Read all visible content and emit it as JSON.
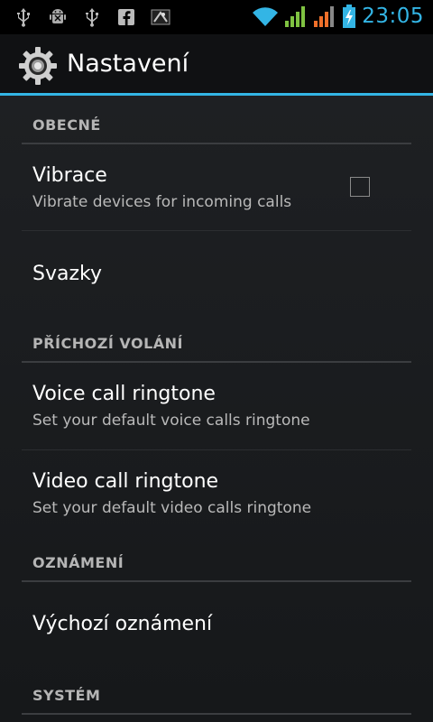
{
  "status_bar": {
    "left_icons": [
      "usb-icon",
      "android-debug-icon",
      "usb-icon",
      "facebook-icon",
      "notification-app-icon"
    ],
    "right_icons": [
      "wifi-icon",
      "signal-icon",
      "signal-roaming-icon",
      "battery-charging-icon"
    ],
    "time": "23:05"
  },
  "action_bar": {
    "title": "Nastavení",
    "icon": "settings-gear-icon"
  },
  "sections": {
    "general": {
      "label": "OBECNÉ"
    },
    "incoming": {
      "label": "PŘÍCHOZÍ VOLÁNÍ"
    },
    "notifications": {
      "label": "OZNÁMENÍ"
    },
    "system": {
      "label": "SYSTÉM"
    }
  },
  "items": {
    "vibrate": {
      "title": "Vibrace",
      "summary": "Vibrate devices for incoming calls",
      "checked": false
    },
    "bundles": {
      "title": "Svazky"
    },
    "voice_ringtone": {
      "title": "Voice call ringtone",
      "summary": "Set your default voice calls ringtone"
    },
    "video_ringtone": {
      "title": "Video call ringtone",
      "summary": "Set your default video calls ringtone"
    },
    "default_notification": {
      "title": "Výchozí oznámení"
    }
  },
  "colors": {
    "accent": "#33b5e5",
    "signal_green": "#7fc241",
    "signal_orange": "#f0702a"
  }
}
